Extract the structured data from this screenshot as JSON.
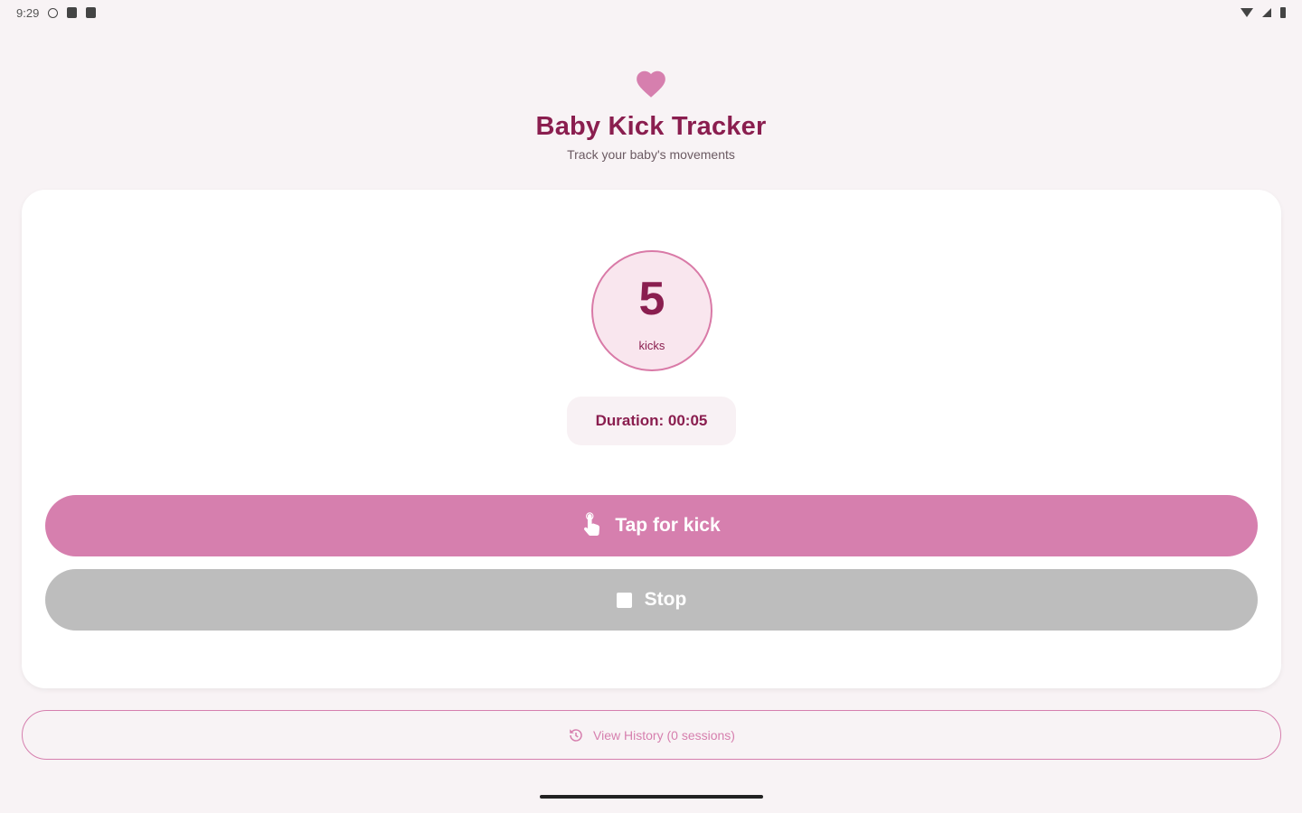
{
  "status_bar": {
    "time": "9:29",
    "icons": [
      "sync-icon",
      "sim-icon",
      "notification-icon"
    ],
    "right_icons": [
      "wifi-icon",
      "signal-icon",
      "battery-icon"
    ]
  },
  "header": {
    "icon": "heart-icon",
    "title": "Baby Kick Tracker",
    "subtitle": "Track your baby's movements"
  },
  "counter": {
    "count": "5",
    "unit": "kicks"
  },
  "duration": {
    "text": "Duration: 00:05"
  },
  "buttons": {
    "kick_label": "Tap for kick",
    "stop_label": "Stop",
    "history_label": "View History (0 sessions)"
  },
  "colors": {
    "accent": "#d67fae",
    "title": "#8a1e4f",
    "background": "#f8f3f5",
    "disabled": "#bdbdbd"
  }
}
